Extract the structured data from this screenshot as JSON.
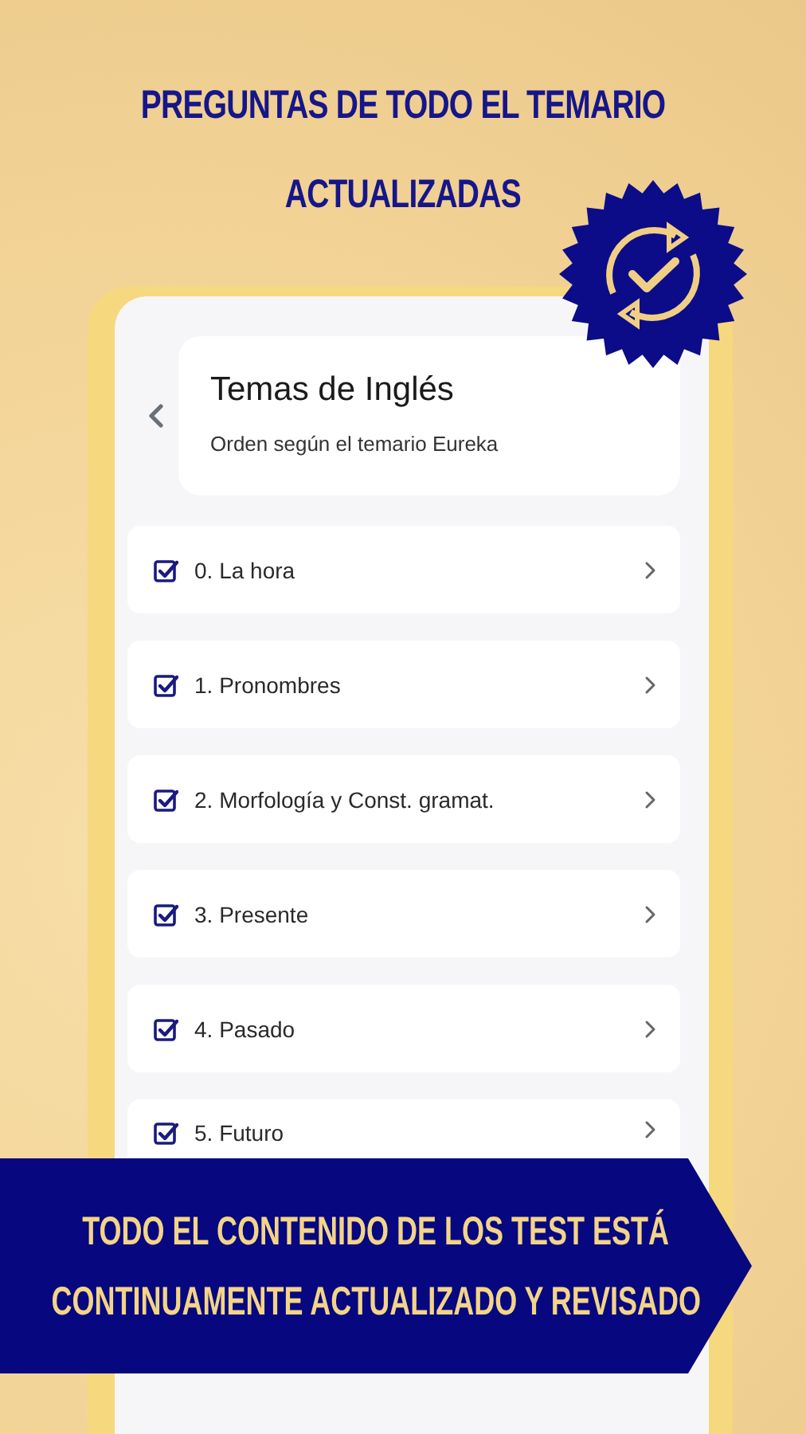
{
  "headline": [
    "PREGUNTAS DE TODO EL TEMARIO",
    "ACTUALIZADAS"
  ],
  "screen": {
    "title": "Temas de Inglés",
    "subtitle": "Orden según el temario Eureka"
  },
  "topics": [
    {
      "label": "0. La hora",
      "checked": true
    },
    {
      "label": "1. Pronombres",
      "checked": true
    },
    {
      "label": "2. Morfología y Const. gramat.",
      "checked": true
    },
    {
      "label": "3. Presente",
      "checked": true
    },
    {
      "label": "4. Pasado",
      "checked": true
    },
    {
      "label": "5. Futuro",
      "checked": true
    }
  ],
  "banner": [
    "TODO EL CONTENIDO DE LOS TEST ESTÁ",
    "CONTINUAMENTE ACTUALIZADO Y REVISADO"
  ]
}
